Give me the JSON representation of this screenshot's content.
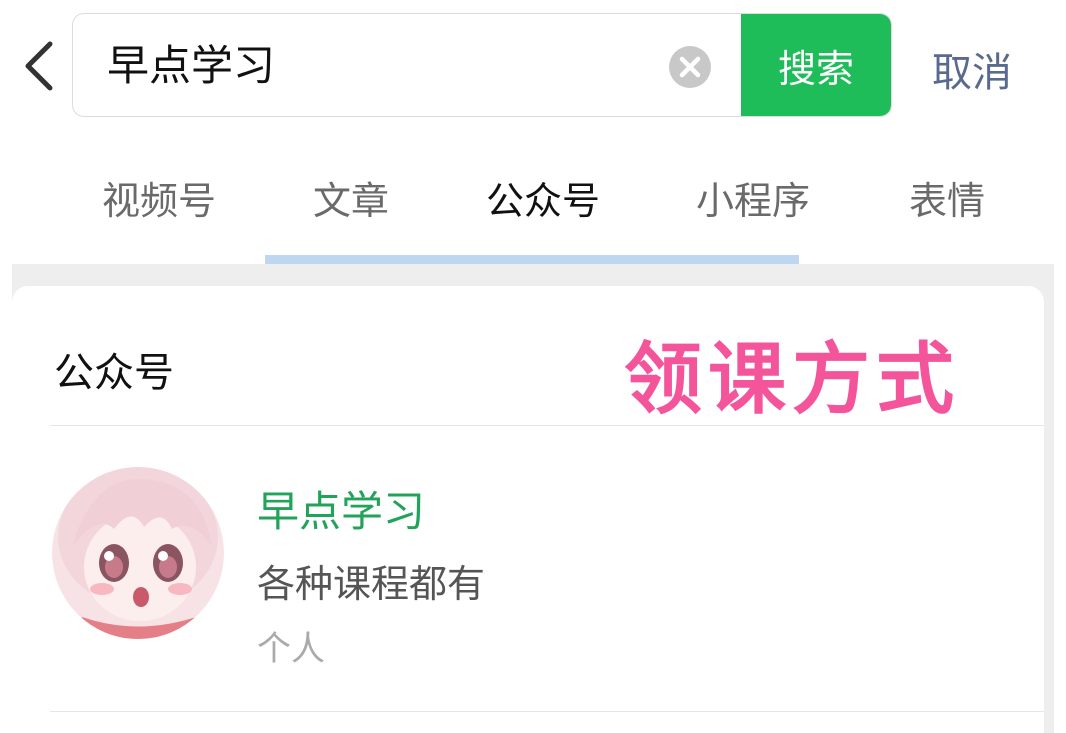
{
  "search": {
    "query": "早点学习",
    "button_label": "搜索",
    "cancel_label": "取消"
  },
  "tabs": [
    {
      "label": "视频号",
      "active": false
    },
    {
      "label": "文章",
      "active": false
    },
    {
      "label": "公众号",
      "active": true
    },
    {
      "label": "小程序",
      "active": false
    },
    {
      "label": "表情",
      "active": false
    }
  ],
  "section": {
    "title": "公众号",
    "overlay_text": "领课方式"
  },
  "result": {
    "name": "早点学习",
    "description": "各种课程都有",
    "type": "个人"
  },
  "colors": {
    "accent_green": "#1fbd5a",
    "name_green": "#22a35a",
    "cancel_blue": "#5a6a8e",
    "overlay_pink": "#f4559a",
    "tab_indicator": "#bcd7ef"
  }
}
